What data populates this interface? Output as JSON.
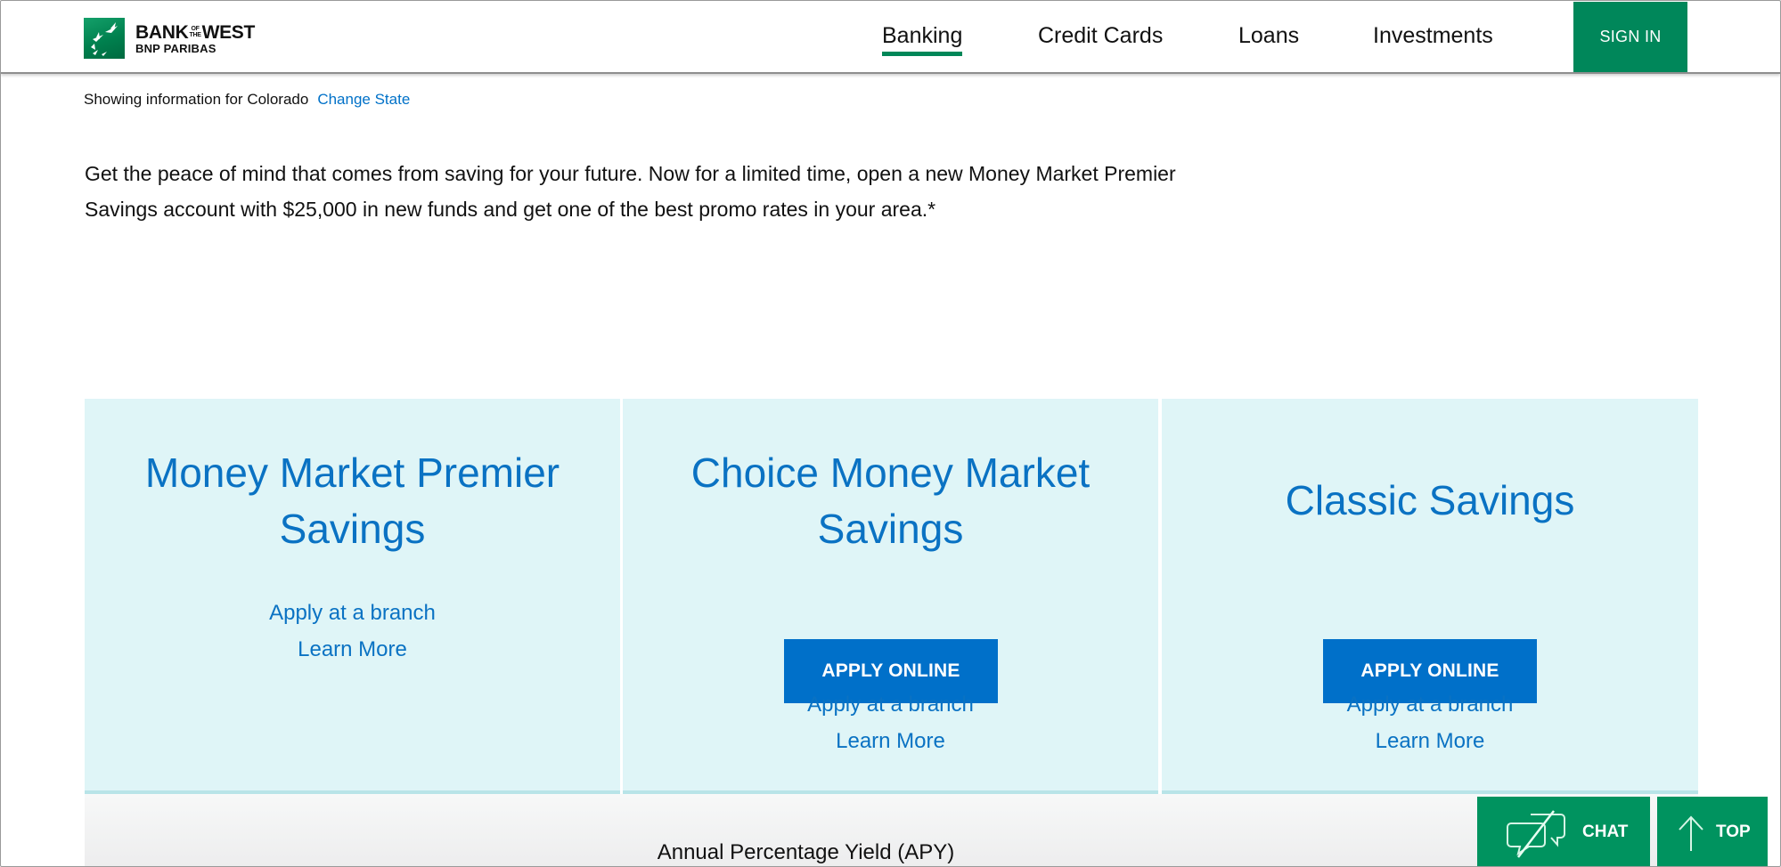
{
  "brand": {
    "name_line1_left": "BANK",
    "name_of": "OF",
    "name_the": "THE",
    "name_line1_right": "WEST",
    "name_line2": "BNP PARIBAS",
    "primary_color": "#00875a",
    "link_color": "#0071c8"
  },
  "nav": {
    "items": [
      {
        "label": "Banking",
        "active": true
      },
      {
        "label": "Credit Cards",
        "active": false
      },
      {
        "label": "Loans",
        "active": false
      },
      {
        "label": "Investments",
        "active": false
      }
    ],
    "sign_in_label": "SIGN IN"
  },
  "location": {
    "text": "Showing information for Colorado",
    "change_label": "Change State"
  },
  "intro": {
    "line1": "Get the peace of mind that comes from saving for your future. Now for a limited time, open a new Money Market Premier",
    "line2": "Savings account with $25,000 in new funds and get one of the best promo rates in your area.*"
  },
  "cards": [
    {
      "title_line1": "Money Market Premier",
      "title_line2": "Savings",
      "apply_online": null,
      "apply_branch": "Apply at a branch",
      "learn_more": "Learn More"
    },
    {
      "title_line1": "Choice Money Market",
      "title_line2": "Savings",
      "apply_online": "APPLY ONLINE",
      "apply_branch": "Apply at a branch",
      "learn_more": "Learn More"
    },
    {
      "title_line1": "Classic Savings",
      "title_line2": null,
      "apply_online": "APPLY ONLINE",
      "apply_branch": "Apply at a branch",
      "learn_more": "Learn More"
    }
  ],
  "apy": {
    "title": "Annual Percentage Yield (APY)"
  },
  "floating": {
    "chat_label": "CHAT",
    "chat_icon": "chat-disabled-icon",
    "top_label": "TOP",
    "top_icon": "arrow-up-icon"
  }
}
